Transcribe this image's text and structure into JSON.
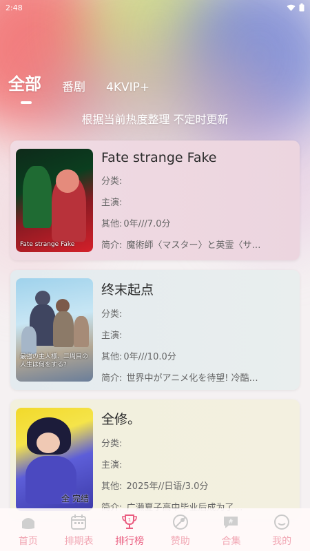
{
  "status_bar": {
    "time": "2:48"
  },
  "tabs": [
    {
      "label": "全部",
      "active": true
    },
    {
      "label": "番剧",
      "active": false
    },
    {
      "label": "4KVIP+",
      "active": false
    }
  ],
  "subtitle": "根据当前热度整理 不定时更新",
  "labels": {
    "category": "分类:",
    "cast": "主演:",
    "other": "其他:",
    "intro": "简介:"
  },
  "cards": [
    {
      "title": "Fate strange Fake",
      "category": "",
      "cast": "",
      "other": "0年///7.0分",
      "intro": "魔術師〈マスター〉と英霊〈サ…",
      "poster_caption": "Fate strange Fake"
    },
    {
      "title": "终末起点",
      "category": "",
      "cast": "",
      "other": "0年///10.0分",
      "intro": "世界中がアニメ化を待望! 冷酷…",
      "poster_caption": "最強の主人様、二周目の人生は何をする?"
    },
    {
      "title": "全修。",
      "category": "",
      "cast": "",
      "other": "2025年//日语/3.0分",
      "intro": "广濑夏子高中毕业后成为了…",
      "poster_caption": "全 完结"
    }
  ],
  "bottom_nav": [
    {
      "label": "首页",
      "icon": "home-icon"
    },
    {
      "label": "排期表",
      "icon": "calendar-icon"
    },
    {
      "label": "排行榜",
      "icon": "trophy-icon",
      "active": true
    },
    {
      "label": "赞助",
      "icon": "sponsor-icon"
    },
    {
      "label": "合集",
      "icon": "collection-chat-icon"
    },
    {
      "label": "我的",
      "icon": "profile-icon"
    }
  ],
  "colors": {
    "accent": "#ea5d80",
    "nav_inactive": "#f1a7b4"
  }
}
